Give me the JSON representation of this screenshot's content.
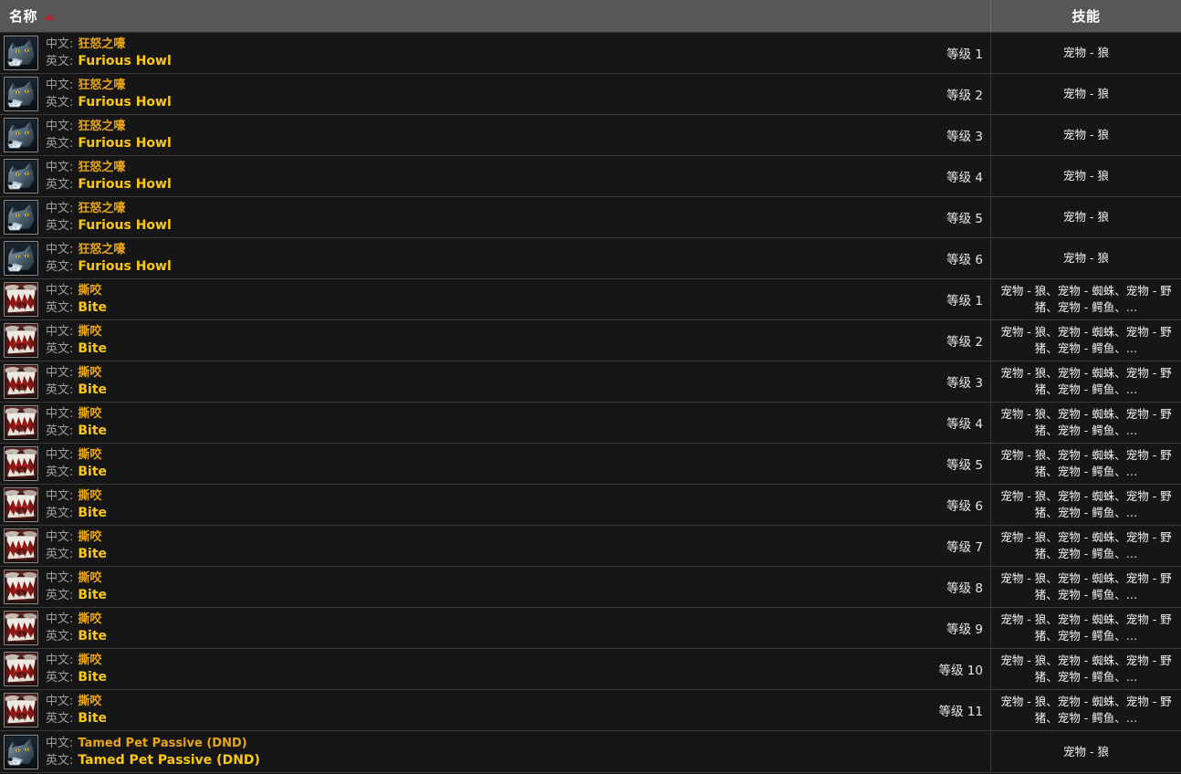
{
  "table": {
    "columns": [
      {
        "label": "名称",
        "sort": "asc",
        "sort_icon": "triangle-up-icon"
      },
      {
        "label": "技能"
      }
    ],
    "labels": {
      "zh": "中文:",
      "en": "英文:"
    },
    "colors": {
      "header_bg": "#575757",
      "row_bg": "#161616",
      "row_border": "#3a3a3a",
      "name_zh": "#e8a517",
      "name_en": "#f9c715",
      "label_gray": "#9d9d9d",
      "sort_arrow": "#b02a2a",
      "skill_text": "#f2f2f2"
    },
    "rows": [
      {
        "icon": "wolf-head-icon",
        "zh": "狂怒之嚎",
        "en": "Furious Howl",
        "rank": "等级 1",
        "skill": "宠物 - 狼",
        "type": "howl"
      },
      {
        "icon": "wolf-head-icon",
        "zh": "狂怒之嚎",
        "en": "Furious Howl",
        "rank": "等级 2",
        "skill": "宠物 - 狼",
        "type": "howl"
      },
      {
        "icon": "wolf-head-icon",
        "zh": "狂怒之嚎",
        "en": "Furious Howl",
        "rank": "等级 3",
        "skill": "宠物 - 狼",
        "type": "howl"
      },
      {
        "icon": "wolf-head-icon",
        "zh": "狂怒之嚎",
        "en": "Furious Howl",
        "rank": "等级 4",
        "skill": "宠物 - 狼",
        "type": "howl"
      },
      {
        "icon": "wolf-head-icon",
        "zh": "狂怒之嚎",
        "en": "Furious Howl",
        "rank": "等级 5",
        "skill": "宠物 - 狼",
        "type": "howl"
      },
      {
        "icon": "wolf-head-icon",
        "zh": "狂怒之嚎",
        "en": "Furious Howl",
        "rank": "等级 6",
        "skill": "宠物 - 狼",
        "type": "howl"
      },
      {
        "icon": "fanged-maw-icon",
        "zh": "撕咬",
        "en": "Bite",
        "rank": "等级 1",
        "skill": "宠物 - 狼、宠物 - 蜘蛛、宠物 - 野猪、宠物 - 鳄鱼、…",
        "type": "bite"
      },
      {
        "icon": "fanged-maw-icon",
        "zh": "撕咬",
        "en": "Bite",
        "rank": "等级 2",
        "skill": "宠物 - 狼、宠物 - 蜘蛛、宠物 - 野猪、宠物 - 鳄鱼、…",
        "type": "bite"
      },
      {
        "icon": "fanged-maw-icon",
        "zh": "撕咬",
        "en": "Bite",
        "rank": "等级 3",
        "skill": "宠物 - 狼、宠物 - 蜘蛛、宠物 - 野猪、宠物 - 鳄鱼、…",
        "type": "bite"
      },
      {
        "icon": "fanged-maw-icon",
        "zh": "撕咬",
        "en": "Bite",
        "rank": "等级 4",
        "skill": "宠物 - 狼、宠物 - 蜘蛛、宠物 - 野猪、宠物 - 鳄鱼、…",
        "type": "bite"
      },
      {
        "icon": "fanged-maw-icon",
        "zh": "撕咬",
        "en": "Bite",
        "rank": "等级 5",
        "skill": "宠物 - 狼、宠物 - 蜘蛛、宠物 - 野猪、宠物 - 鳄鱼、…",
        "type": "bite"
      },
      {
        "icon": "fanged-maw-icon",
        "zh": "撕咬",
        "en": "Bite",
        "rank": "等级 6",
        "skill": "宠物 - 狼、宠物 - 蜘蛛、宠物 - 野猪、宠物 - 鳄鱼、…",
        "type": "bite"
      },
      {
        "icon": "fanged-maw-icon",
        "zh": "撕咬",
        "en": "Bite",
        "rank": "等级 7",
        "skill": "宠物 - 狼、宠物 - 蜘蛛、宠物 - 野猪、宠物 - 鳄鱼、…",
        "type": "bite"
      },
      {
        "icon": "fanged-maw-icon",
        "zh": "撕咬",
        "en": "Bite",
        "rank": "等级 8",
        "skill": "宠物 - 狼、宠物 - 蜘蛛、宠物 - 野猪、宠物 - 鳄鱼、…",
        "type": "bite"
      },
      {
        "icon": "fanged-maw-icon",
        "zh": "撕咬",
        "en": "Bite",
        "rank": "等级 9",
        "skill": "宠物 - 狼、宠物 - 蜘蛛、宠物 - 野猪、宠物 - 鳄鱼、…",
        "type": "bite"
      },
      {
        "icon": "fanged-maw-icon",
        "zh": "撕咬",
        "en": "Bite",
        "rank": "等级 10",
        "skill": "宠物 - 狼、宠物 - 蜘蛛、宠物 - 野猪、宠物 - 鳄鱼、…",
        "type": "bite"
      },
      {
        "icon": "fanged-maw-icon",
        "zh": "撕咬",
        "en": "Bite",
        "rank": "等级 11",
        "skill": "宠物 - 狼、宠物 - 蜘蛛、宠物 - 野猪、宠物 - 鳄鱼、…",
        "type": "bite"
      },
      {
        "icon": "wolf-head-icon",
        "zh": "Tamed Pet Passive (DND)",
        "en": "Tamed Pet Passive (DND)",
        "rank": "",
        "skill": "宠物 - 狼",
        "type": "tamed"
      }
    ]
  }
}
